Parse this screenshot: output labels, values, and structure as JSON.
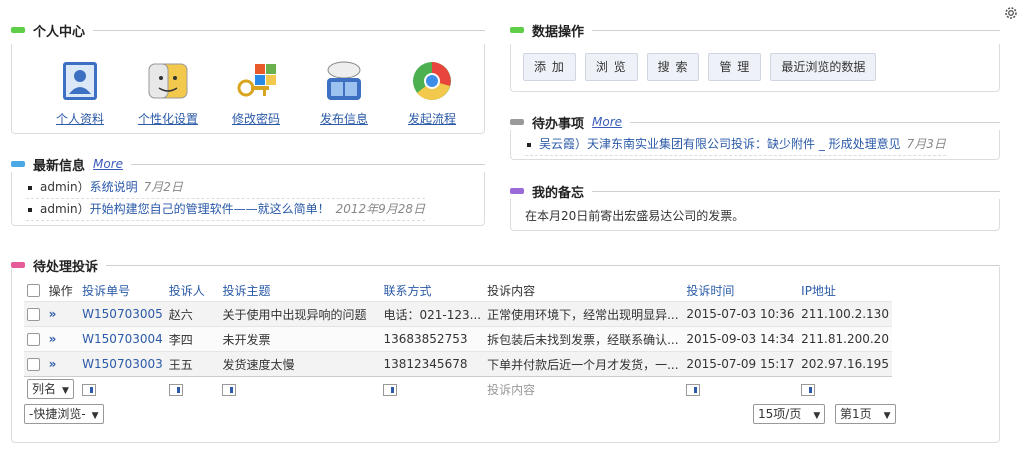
{
  "colors": {
    "green": "#5fcf4a",
    "gray": "#9a9a9a",
    "blue": "#4aa8e6",
    "purple": "#9a6ad8",
    "pink": "#e65b9a",
    "link": "#2b5aa8"
  },
  "personal": {
    "title": "个人中心",
    "items": [
      {
        "label": "个人资料",
        "icon": "profile-icon"
      },
      {
        "label": "个性化设置",
        "icon": "customize-icon"
      },
      {
        "label": "修改密码",
        "icon": "password-key-icon"
      },
      {
        "label": "发布信息",
        "icon": "publish-icon"
      },
      {
        "label": "发起流程",
        "icon": "workflow-icon"
      }
    ]
  },
  "dataops": {
    "title": "数据操作",
    "buttons": [
      "添 加",
      "浏 览",
      "搜 索",
      "管 理",
      "最近浏览的数据"
    ]
  },
  "todo": {
    "title": "待办事项",
    "more": "More",
    "items": [
      {
        "text": "吴云霞）天津东南实业集团有限公司投诉：缺少附件 _ 形成处理意见",
        "date": "7月3日"
      }
    ]
  },
  "news": {
    "title": "最新信息",
    "more": "More",
    "items": [
      {
        "author": "admin）",
        "text": "系统说明",
        "date": "7月2日"
      },
      {
        "author": "admin）",
        "text": "开始构建您自己的管理软件——就这么简单！",
        "date": "2012年9月28日"
      }
    ]
  },
  "memo": {
    "title": "我的备忘",
    "text": "在本月20日前寄出宏盛易达公司的发票。"
  },
  "complaints": {
    "title": "待处理投诉",
    "columns": [
      "操作",
      "投诉单号",
      "投诉人",
      "投诉主题",
      "联系方式",
      "投诉内容",
      "投诉时间",
      "IP地址"
    ],
    "rows": [
      {
        "op": "»",
        "id": "W150703005",
        "person": "赵六",
        "subject": "关于使用中出现异响的问题",
        "contact": "电话：021-123...",
        "content": "正常使用环境下，经常出现明显异...",
        "time": "2015-07-03 10:36",
        "ip": "211.100.2.130"
      },
      {
        "op": "»",
        "id": "W150703004",
        "person": "李四",
        "subject": "未开发票",
        "contact": "13683852753",
        "content": "拆包装后未找到发票，经联系确认...",
        "time": "2015-09-03 14:34",
        "ip": "211.81.200.20"
      },
      {
        "op": "»",
        "id": "W150703003",
        "person": "王五",
        "subject": "发货速度太慢",
        "contact": "13812345678",
        "content": "下单并付款后近一个月才发货，一...",
        "time": "2015-07-09 15:17",
        "ip": "202.97.16.195"
      }
    ],
    "filter_select": "列名",
    "filter_content_placeholder": "投诉内容",
    "quick_browse": "-快捷浏览-",
    "page_size": "15项/页",
    "page_no": "第1页"
  }
}
